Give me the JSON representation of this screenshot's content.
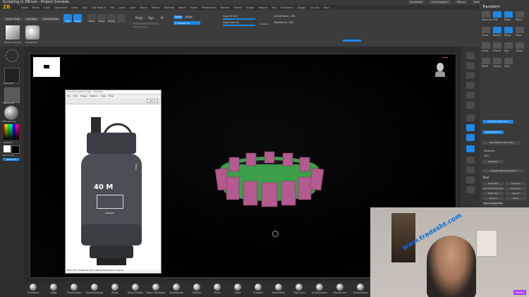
{
  "app": {
    "title": "Sculpting in ZBrush - Project Grenade",
    "logo": "ZB"
  },
  "menu": [
    "Alpha",
    "Brush",
    "Color",
    "Document",
    "Draw",
    "Edit",
    "Edit Texture",
    "File",
    "Layer",
    "Light",
    "Macro",
    "Marker",
    "Material",
    "Movie",
    "Picker",
    "Preferences",
    "Render",
    "Stencil",
    "Stroke",
    "Texture",
    "Tool",
    "Transform",
    "Zplugin",
    "Zscript",
    "Help"
  ],
  "topright": {
    "quicksave": "QuickSave",
    "see_through": "See-through 0",
    "menus": "Menus",
    "default_script": "DefaultZScript"
  },
  "shelf": {
    "tabs": [
      "Home Page",
      "LightBox",
      "Live Boolean"
    ],
    "edit": "Edit",
    "draw": "Draw",
    "move": "Move",
    "scale": "Scale",
    "rotate": "Rotate",
    "mrgb": "Mrgb",
    "rgb": "Rgb",
    "m": "M",
    "zadd": "Zadd",
    "zsub": "Zsub",
    "zcut": "Zcut",
    "rgb_intensity": "Rgb Intensity",
    "z_intensity": "Z Intensity 25",
    "focal_shift": "Focal Shift 0",
    "draw_size": "Draw Size 64",
    "dynamic": "Dynamic",
    "active_points": "ActivePoints: 198",
    "total_points": "TotalPoints: 198",
    "polymesh_label": "PM3D_Polymesh",
    "polysphere_label": "PolySphere"
  },
  "left": {
    "alpha": "Alpha Off",
    "texture": "Texture Off",
    "matcap": "MatCap Gray",
    "gradient": "Gradient",
    "switch": "SwitchColor",
    "alternate": "Alternate"
  },
  "right": {
    "header": "Transform",
    "buttons": [
      "Save As",
      "Edit",
      "Draw",
      "Move",
      "Scale",
      "Rotate",
      "Persp",
      "Floor",
      "Local",
      "Frame",
      "Xyz",
      "Ghost",
      "PolyF",
      "Transp",
      "Solo"
    ],
    "activate_symmetry": "Activate Symmetry",
    "use_posable": "Use Posable Symmetry",
    "radial_count": "RadialCount 8",
    "modifiers": "Modifiers",
    "info": "Info",
    "rs_gizmo": "3D Gizmo",
    "analyze": "Analyze Selected Subtool",
    "tool": "Tool",
    "tool_buttons": [
      "Load Tool",
      "Save As",
      "Load Tools From Project",
      "Copy Tool",
      "Paste Tool",
      "Import",
      "Export",
      "Clone",
      "Make PolyMesh3D"
    ]
  },
  "brushes": [
    "Standard",
    "Inflat",
    "ClayBuildup",
    "DamStandard",
    "Move",
    "Move Elastic",
    "Move Topologic",
    "SnakeHook",
    "hPolish",
    "Pinch",
    "Slash",
    "Smooth",
    "SelectRect",
    "ClipCurve",
    "TrimDynamic",
    "SliceCurve",
    "SelectLasso",
    "Transpose"
  ],
  "refwindow": {
    "title": "Grenade_reference.jpg - IrfanView",
    "menu": [
      "File",
      "Edit",
      "Image",
      "Options",
      "View",
      "Help"
    ],
    "label_big": "40 M",
    "label_side": "FRAG",
    "label_sub": "DANGER",
    "zoom": "100 %",
    "status": "500 x 767 x 24 BPP   2/2   100 %   150.38 KB   6/7/2019 / 15:36:01"
  },
  "webcam": {
    "watermark": "www.tradesht.com",
    "badge": "Udemy"
  },
  "colors": {
    "accent": "#1e88e5",
    "green": "#3d9e4a",
    "pink": "#b35a8f"
  }
}
